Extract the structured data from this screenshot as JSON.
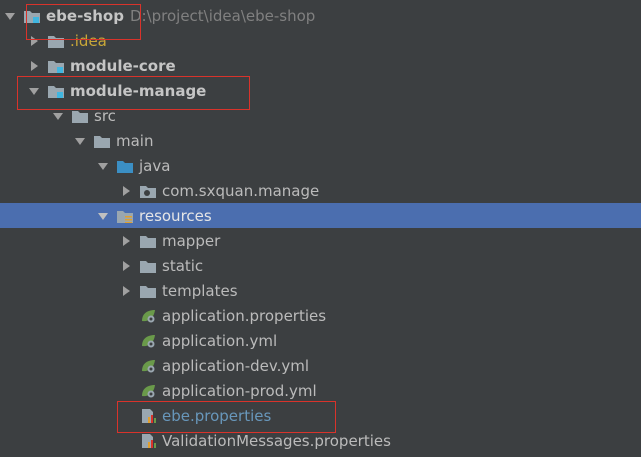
{
  "tree": {
    "rows": [
      {
        "label": "ebe-shop",
        "path": "D:\\project\\idea\\ebe-shop",
        "icon": "module-folder-icon",
        "arrow": "expanded"
      },
      {
        "label": ".idea",
        "icon": "folder-icon",
        "arrow": "collapsed"
      },
      {
        "label": "module-core",
        "icon": "module-folder-icon",
        "arrow": "collapsed"
      },
      {
        "label": "module-manage",
        "icon": "module-folder-icon",
        "arrow": "expanded"
      },
      {
        "label": "src",
        "icon": "folder-icon",
        "arrow": "expanded"
      },
      {
        "label": "main",
        "icon": "folder-icon",
        "arrow": "expanded"
      },
      {
        "label": "java",
        "icon": "source-folder-icon",
        "arrow": "expanded"
      },
      {
        "label": "com.sxquan.manage",
        "icon": "package-icon",
        "arrow": "collapsed"
      },
      {
        "label": "resources",
        "icon": "resources-folder-icon",
        "arrow": "expanded",
        "selected": true
      },
      {
        "label": "mapper",
        "icon": "folder-icon",
        "arrow": "collapsed"
      },
      {
        "label": "static",
        "icon": "folder-icon",
        "arrow": "collapsed"
      },
      {
        "label": "templates",
        "icon": "folder-icon",
        "arrow": "collapsed"
      },
      {
        "label": "application.properties",
        "icon": "spring-config-icon",
        "arrow": "none"
      },
      {
        "label": "application.yml",
        "icon": "spring-config-icon",
        "arrow": "none"
      },
      {
        "label": "application-dev.yml",
        "icon": "spring-config-icon",
        "arrow": "none"
      },
      {
        "label": "application-prod.yml",
        "icon": "spring-config-icon",
        "arrow": "none"
      },
      {
        "label": "ebe.properties",
        "icon": "properties-file-icon",
        "arrow": "none"
      },
      {
        "label": "ValidationMessages.properties",
        "icon": "properties-file-icon",
        "arrow": "none"
      }
    ]
  },
  "colors": {
    "background": "#3c3f41",
    "selection": "#4b6eaf",
    "highlight_border": "#d9332b",
    "text": "#bbbbbb",
    "idea_text": "#c9a838",
    "ebe_text": "#6897bb"
  }
}
